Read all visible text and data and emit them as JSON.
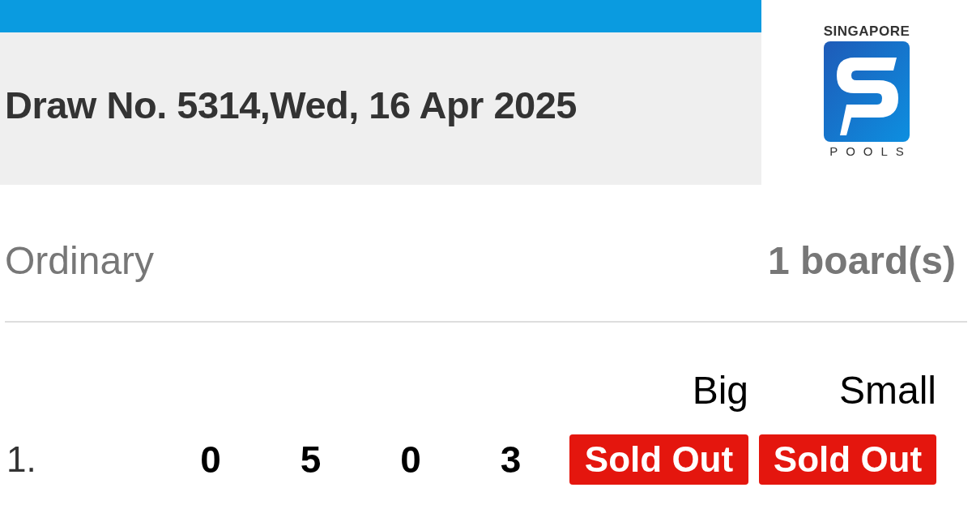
{
  "header": {
    "title": "Draw No. 5314,Wed, 16 Apr 2025"
  },
  "logo": {
    "top_text": "SINGAPORE",
    "bottom_text": "POOLS"
  },
  "bet": {
    "type": "Ordinary",
    "boards": "1 board(s)"
  },
  "columns": [
    "Big",
    "Small"
  ],
  "rows": [
    {
      "index": "1.",
      "digits": [
        "0",
        "5",
        "0",
        "3"
      ],
      "prizes": [
        {
          "text": "Sold Out",
          "kind": "sold-out"
        },
        {
          "text": "Sold Out",
          "kind": "sold-out"
        }
      ]
    }
  ]
}
